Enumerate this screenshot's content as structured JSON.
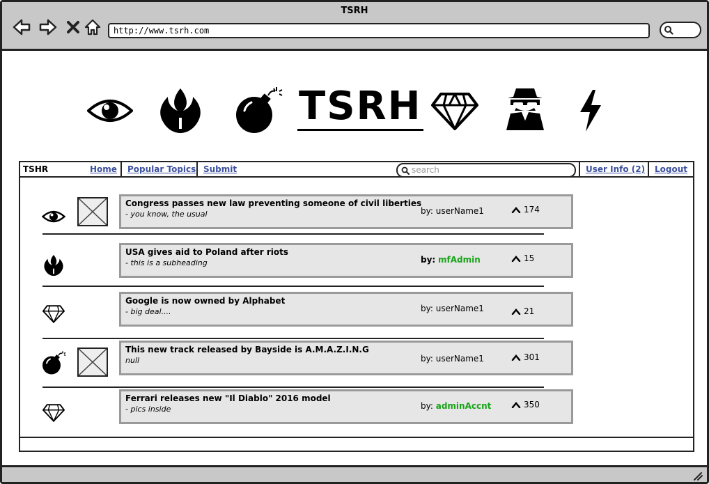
{
  "window": {
    "title": "TSRH",
    "url": "http://www.tsrh.com"
  },
  "logo": {
    "text": "TSRH",
    "icons": [
      "eye-icon",
      "rebel-alliance-icon",
      "bomb-icon",
      "diamond-icon",
      "spy-icon",
      "lightning-bolt-icon"
    ]
  },
  "nav": {
    "brand": "TSHR",
    "links": [
      {
        "label": "Home"
      },
      {
        "label": "Popular Topics"
      },
      {
        "label": "Submit"
      }
    ],
    "search_placeholder": "search",
    "user_info": "User Info (2)",
    "logout": "Logout"
  },
  "posts": [
    {
      "icon": "eye-icon",
      "has_thumb": true,
      "title": "Congress passes new law preventing someone of civil liberties",
      "subheading": "- you know, the usual",
      "by_label": "by:",
      "author": "userName1",
      "author_is_admin": false,
      "votes": "174"
    },
    {
      "icon": "rebel-alliance-icon",
      "has_thumb": false,
      "title": "USA gives aid to Poland after riots",
      "subheading": "- this is a subheading",
      "by_label": "by:",
      "author": "mfAdmin",
      "author_is_admin": true,
      "votes": "15"
    },
    {
      "icon": "diamond-icon",
      "has_thumb": false,
      "title": "Google is now owned by Alphabet",
      "subheading": "- big deal....",
      "by_label": "by:",
      "author": "userName1",
      "author_is_admin": false,
      "votes": "21"
    },
    {
      "icon": "bomb-icon",
      "has_thumb": true,
      "title": "This new track released by Bayside is A.M.A.Z.I.N.G",
      "subheading": "null",
      "by_label": "by:",
      "author": "userName1",
      "author_is_admin": false,
      "votes": "301"
    },
    {
      "icon": "diamond-icon",
      "has_thumb": false,
      "title": "Ferrari releases new \"Il Diablo\" 2016 model",
      "subheading": "- pics inside",
      "by_label": "by:",
      "author": "adminAccnt",
      "author_is_admin": true,
      "votes": "350"
    }
  ],
  "colors": {
    "link": "#3b4f9e",
    "admin": "#19a319",
    "chrome": "#c8c8c8",
    "card": "#e6e6e6"
  }
}
